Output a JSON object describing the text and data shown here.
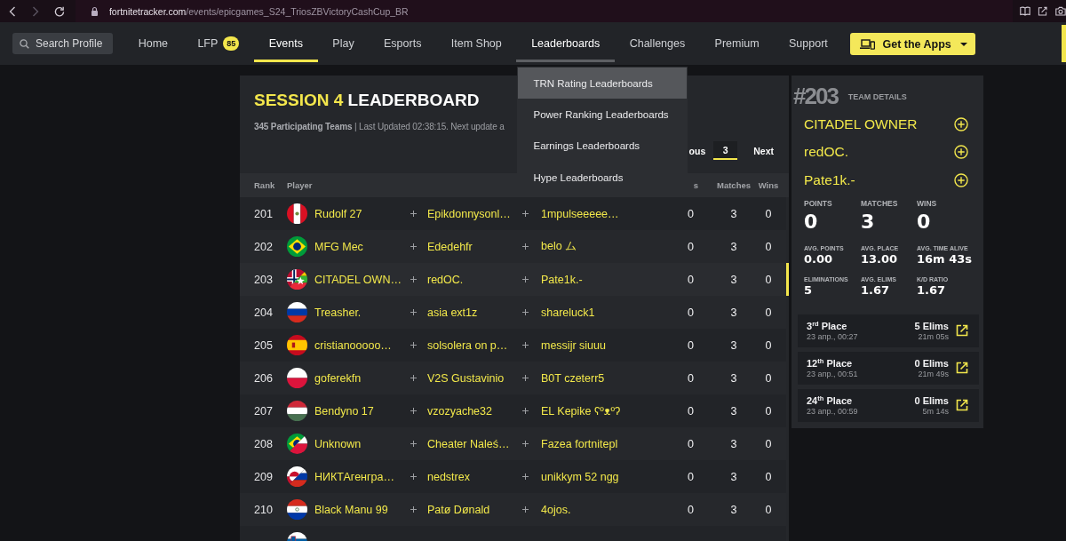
{
  "browser": {
    "url_host": "fortnitetracker.com",
    "url_path": "/events/epicgames_S24_TriosZBVictoryCashCup_BR"
  },
  "nav": {
    "search": {
      "placeholder": "Search Profile"
    },
    "items": [
      {
        "label": "Home",
        "selected": false,
        "expanded": false
      },
      {
        "label": "LFP",
        "badge": "85",
        "selected": false,
        "expanded": false
      },
      {
        "label": "Events",
        "selected": true,
        "expanded": false
      },
      {
        "label": "Play",
        "selected": false,
        "expanded": false
      },
      {
        "label": "Esports",
        "selected": false,
        "expanded": false
      },
      {
        "label": "Item Shop",
        "selected": false,
        "expanded": false
      },
      {
        "label": "Leaderboards",
        "selected": false,
        "expanded": true,
        "menu": [
          {
            "label": "TRN Rating Leaderboards",
            "selected": true
          },
          {
            "label": "Power Ranking Leaderboards",
            "selected": false
          },
          {
            "label": "Earnings Leaderboards",
            "selected": false
          },
          {
            "label": "Hype Leaderboards",
            "selected": false
          }
        ]
      },
      {
        "label": "Challenges",
        "selected": false,
        "expanded": false
      },
      {
        "label": "Premium",
        "selected": false,
        "expanded": false
      },
      {
        "label": "Support",
        "selected": false,
        "expanded": false
      }
    ],
    "apps_button": "Get the Apps"
  },
  "leaderboard": {
    "title_highlight": "SESSION 4",
    "title": "LEADERBOARD",
    "subtitle": "**345 Participating Teams** | Last Updated 02:38:15. Next update a",
    "pagination": [
      {
        "label": "ous",
        "selected": false
      },
      {
        "label": "3",
        "selected": true
      },
      {
        "label": "Next",
        "selected": false
      }
    ],
    "table": {
      "columns": [
        "Rank",
        "Player",
        "s",
        "Matches",
        "Wins"
      ],
      "rows": [
        {
          "rank": "201",
          "flag": {
            "kind": "pe"
          },
          "players": [
            "Rudolf 27",
            "Epikdonnysonl…",
            "1mpulseeeee…"
          ],
          "points": "0",
          "matches": "3",
          "wins": "0",
          "selected": false
        },
        {
          "rank": "202",
          "flag": {
            "kind": "br"
          },
          "players": [
            "MFG Mec",
            "Ededehfr",
            "belo ム"
          ],
          "points": "0",
          "matches": "3",
          "wins": "0",
          "selected": false
        },
        {
          "rank": "203",
          "flag": {
            "kind": "no_mm"
          },
          "players": [
            "CITADEL OWN…",
            "redOC.",
            "Pate1k.-"
          ],
          "points": "0",
          "matches": "3",
          "wins": "0",
          "selected": true
        },
        {
          "rank": "204",
          "flag": {
            "kind": "ru"
          },
          "players": [
            "Treasher.",
            "asia ext1z",
            "shareluck1"
          ],
          "points": "0",
          "matches": "3",
          "wins": "0",
          "selected": false
        },
        {
          "rank": "205",
          "flag": {
            "kind": "es"
          },
          "players": [
            "cristianooooo…",
            "solsolera on p…",
            "messijr siuuu"
          ],
          "points": "0",
          "matches": "3",
          "wins": "0",
          "selected": false
        },
        {
          "rank": "206",
          "flag": {
            "kind": "pl"
          },
          "players": [
            "goferekfn",
            "V2S Gustavinio",
            "B0T czeterr5"
          ],
          "points": "0",
          "matches": "3",
          "wins": "0",
          "selected": false
        },
        {
          "rank": "207",
          "flag": {
            "kind": "hu"
          },
          "players": [
            "Bendyno 17",
            "vzozyache32",
            "EL Kepike ʕºᴥºʔ"
          ],
          "points": "0",
          "matches": "3",
          "wins": "0",
          "selected": false
        },
        {
          "rank": "208",
          "flag": {
            "kind": "br_pl"
          },
          "players": [
            "Unknown",
            "Cheater Naleś…",
            "Fazea fortnitepl"
          ],
          "points": "0",
          "matches": "3",
          "wins": "0",
          "selected": false
        },
        {
          "rank": "209",
          "flag": {
            "kind": "gl_ru"
          },
          "players": [
            "НИКТАгенгра…",
            "nedstrex",
            "unikkym 52 ngg"
          ],
          "points": "0",
          "matches": "3",
          "wins": "0",
          "selected": false
        },
        {
          "rank": "210",
          "flag": {
            "kind": "py"
          },
          "players": [
            "Black Manu 99",
            "Patø Dønald",
            "4ojos."
          ],
          "points": "0",
          "matches": "3",
          "wins": "0",
          "selected": false
        },
        {
          "flag": {
            "kind": "si"
          },
          "selected": false
        }
      ]
    }
  },
  "team": {
    "rank": "#203",
    "heading": "TEAM DETAILS",
    "players": [
      "CITADEL OWNER",
      "redOC.",
      "Pate1k.-"
    ],
    "stats": [
      {
        "label": "POINTS",
        "value": "0",
        "kind": "main"
      },
      {
        "label": "MATCHES",
        "value": "3",
        "kind": "main"
      },
      {
        "label": "WINS",
        "value": "0",
        "kind": "main"
      },
      {
        "label": "AVG. POINTS",
        "value": "0.00",
        "kind": "minor"
      },
      {
        "label": "AVG. PLACE",
        "value": "13.00",
        "kind": "minor"
      },
      {
        "label": "AVG. TIME ALIVE",
        "value": "16m 43s",
        "kind": "minor"
      },
      {
        "label": "ELIMINATIONS",
        "value": "5",
        "kind": "minor"
      },
      {
        "label": "AVG. ELIMS",
        "value": "1.67",
        "kind": "minor"
      },
      {
        "label": "K/D RATIO",
        "value": "1.67",
        "kind": "minor"
      }
    ],
    "matches": [
      {
        "place": "3$^{rd}$ Place",
        "time": "23 апр., 00:27",
        "elims": "5 Elims",
        "duration": "21m 05s"
      },
      {
        "place": "12$^{th}$ Place",
        "time": "23 апр., 00:51",
        "elims": "0 Elims",
        "duration": "21m 49s"
      },
      {
        "place": "24$^{th}$ Place",
        "time": "23 апр., 00:59",
        "elims": "0 Elims",
        "duration": "5m 14s"
      }
    ]
  }
}
